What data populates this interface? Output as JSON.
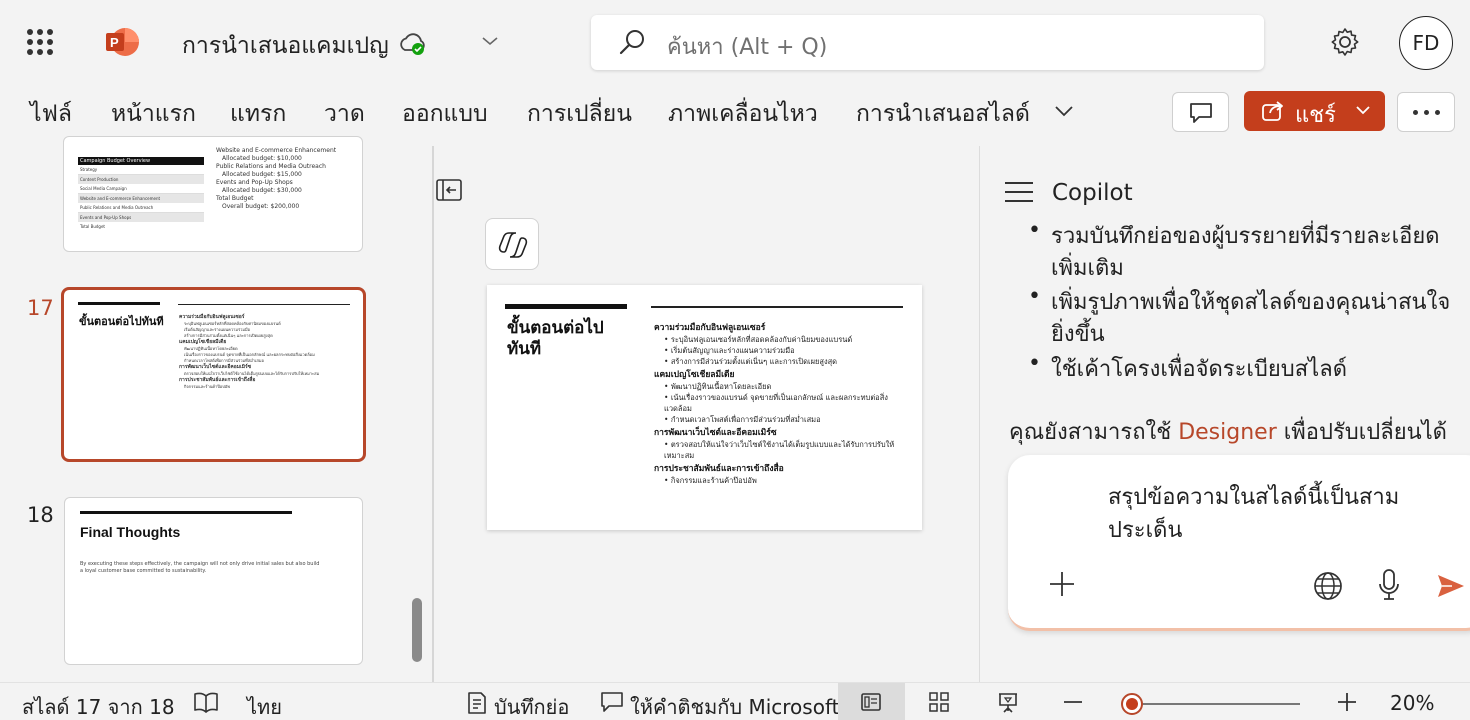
{
  "app": {
    "title": "การนำเสนอแคมเปญ",
    "search_placeholder": "ค้นหา (Alt + Q)",
    "avatar_initials": "FD",
    "brand_color": "#c43e1c"
  },
  "ribbon": {
    "tabs": [
      "ไฟล์",
      "หน้าแรก",
      "แทรก",
      "วาด",
      "ออกแบบ",
      "การเปลี่ยน",
      "ภาพเคลื่อนไหว",
      "การนำเสนอสไลด์"
    ],
    "share_label": "แชร์"
  },
  "thumbnails": {
    "prev_slide": {
      "table_header": "Campaign Budget Overview",
      "rows": [
        "Strategy",
        "Content Production",
        "Social Media Campaign",
        "Website and E-commerce Enhancement",
        "Public Relations and Media Outreach",
        "Events and Pop-Up Shops",
        "Total Budget"
      ],
      "bullets": [
        "Website and E-commerce Enhancement",
        "Allocated budget: $10,000",
        "Public Relations and Media Outreach",
        "Allocated budget: $15,000",
        "Events and Pop-Up Shops",
        "Allocated budget: $30,000",
        "Total Budget",
        "Overall budget: $200,000"
      ]
    },
    "slide17": {
      "number": "17",
      "title": "ขั้นตอนต่อไปทันที"
    },
    "slide18": {
      "number": "18",
      "title": "Final Thoughts",
      "body": "By executing these steps effectively, the campaign will not only drive initial sales but also build a loyal customer base committed to sustainability."
    }
  },
  "main_slide": {
    "title_line1": "ขั้นตอนต่อไป",
    "title_line2": "ทันที",
    "sections": [
      {
        "heading": "ความร่วมมือกับอินฟลูเอนเซอร์",
        "items": [
          "ระบุอินฟลูเอนเซอร์หลักที่สอดคล้องกับค่านิยมของแบรนด์",
          "เริ่มต้นสัญญาและร่างแผนความร่วมมือ",
          "สร้างการมีส่วนร่วมตั้งแต่เนิ่นๆ และการเปิดเผยสูงสุด"
        ]
      },
      {
        "heading": "แคมเปญโซเชียลมีเดีย",
        "items": [
          "พัฒนาปฏิทินเนื้อหาโดยละเอียด",
          "เน้นเรื่องราวของแบรนด์ จุดขายที่เป็นเอกลักษณ์ และผลกระทบต่อสิ่งแวดล้อม",
          "กำหนดเวลาโพสต์เพื่อการมีส่วนร่วมที่สม่ำเสมอ"
        ]
      },
      {
        "heading": "การพัฒนาเว็บไซต์และอีคอมเมิร์ซ",
        "items": [
          "ตรวจสอบให้แน่ใจว่าเว็บไซต์ใช้งานได้เต็มรูปแบบและได้รับการปรับให้เหมาะสม"
        ]
      },
      {
        "heading": "การประชาสัมพันธ์และการเข้าถึงสื่อ",
        "items": [
          "กิจกรรมและร้านค้าป๊อปอัพ"
        ]
      }
    ]
  },
  "copilot": {
    "title": "Copilot",
    "bullets": [
      [
        "รวมบันทึกย่อของผู้บรรยายที่มีรายละเอียด",
        "เพิ่มเติม"
      ],
      [
        "เพิ่มรูปภาพเพื่อให้ชุดสไลด์ของคุณน่าสนใจ",
        "ยิ่งขึ้น"
      ],
      [
        "ใช้เค้าโครงเพื่อจัดระเบียบสไลด์"
      ]
    ],
    "designer_prefix": "คุณยังสามารถใช้ ",
    "designer_word": "Designer",
    "designer_suffix": " เพื่อปรับเปลี่ยนได้",
    "prompt_text": "สรุปข้อความในสไลด์นี้เป็นสามประเด็น"
  },
  "status": {
    "slide_position": "สไลด์ 17 จาก 18",
    "language": "ไทย",
    "notes_label": "บันทึกย่อ",
    "feedback_label": "ให้คำติชมกับ Microsoft",
    "zoom": "20%"
  }
}
